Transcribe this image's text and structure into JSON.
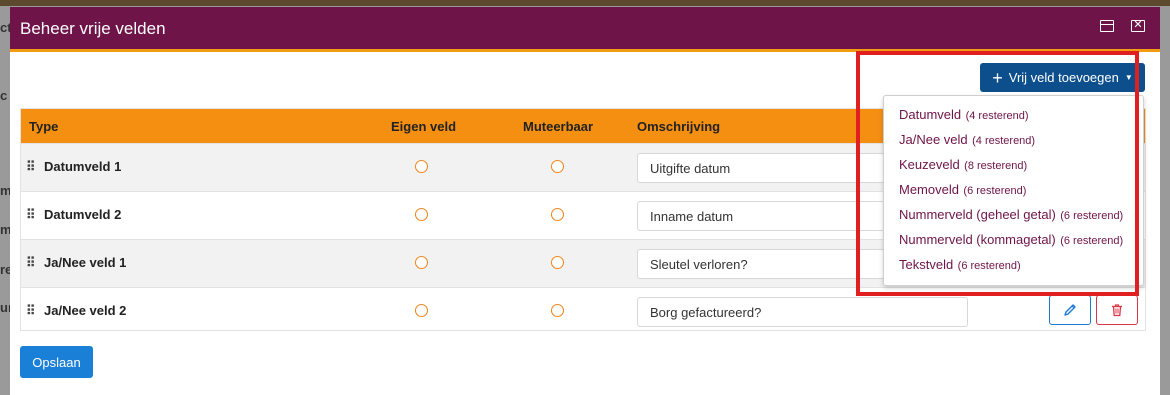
{
  "background": {
    "fragments": [
      "ct",
      "c",
      "m",
      "m",
      "re",
      "ure"
    ]
  },
  "modal": {
    "title": "Beheer vrije velden",
    "header_color": "#6f1449",
    "accent_color": "#f39c12"
  },
  "toolbar": {
    "add_label": "Vrij veld toevoegen"
  },
  "table": {
    "columns": [
      "Type",
      "Eigen veld",
      "Muteerbaar",
      "Omschrijving"
    ],
    "rows": [
      {
        "type": "Datumveld 1",
        "description": "Uitgifte datum"
      },
      {
        "type": "Datumveld 2",
        "description": "Inname datum"
      },
      {
        "type": "Ja/Nee veld 1",
        "description": "Sleutel verloren?"
      },
      {
        "type": "Ja/Nee veld 2",
        "description": "Borg gefactureerd?"
      }
    ]
  },
  "dropdown": {
    "items": [
      {
        "label": "Datumveld",
        "count": "(4 resterend)"
      },
      {
        "label": "Ja/Nee veld",
        "count": "(4 resterend)"
      },
      {
        "label": "Keuzeveld",
        "count": "(8 resterend)"
      },
      {
        "label": "Memoveld",
        "count": "(6 resterend)"
      },
      {
        "label": "Nummerveld (geheel getal)",
        "count": "(6 resterend)"
      },
      {
        "label": "Nummerveld (kommagetal)",
        "count": "(6 resterend)"
      },
      {
        "label": "Tekstveld",
        "count": "(6 resterend)"
      }
    ]
  },
  "footer": {
    "save_label": "Opslaan"
  },
  "icons": {
    "maximize": "window-maximize-icon",
    "close": "close-icon",
    "add": "plus-icon",
    "drag": "drag-handle-icon",
    "edit": "pencil-icon",
    "delete": "trash-icon"
  }
}
